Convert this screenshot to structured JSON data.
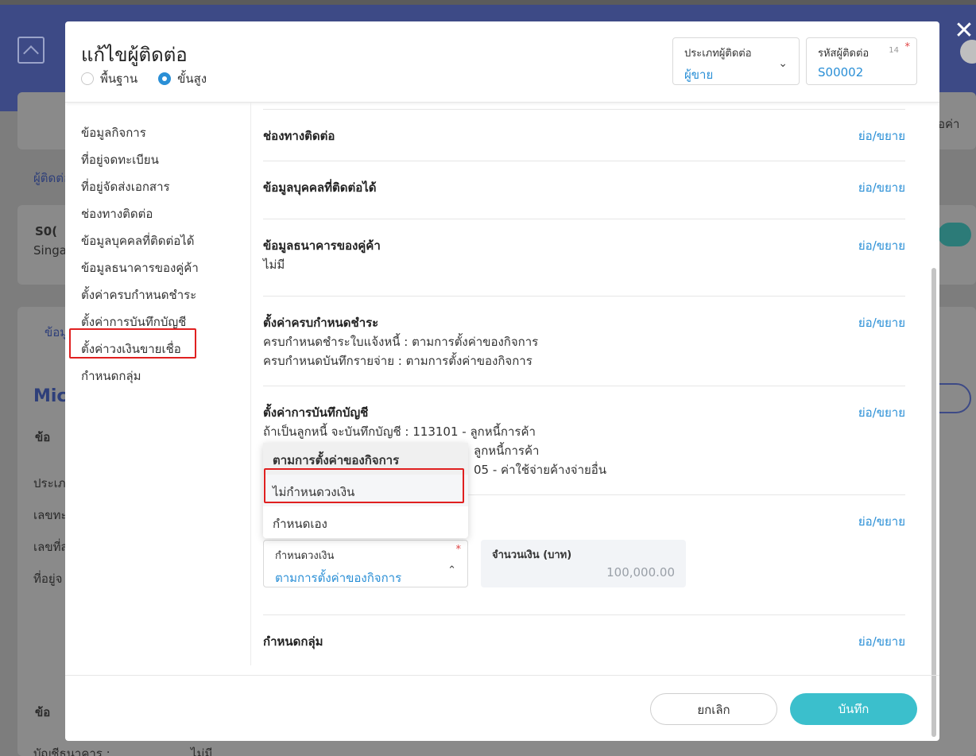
{
  "background": {
    "breadcrumb": "ผู้ติดต่อ",
    "contact_code": "S0(",
    "country": "Singap",
    "tab_label": "ข้อมู",
    "heading": "Mic",
    "section_a": "ข้อ",
    "rows": [
      "ประเภ",
      "เลขทะ",
      "เลขที่ส",
      "ที่อยู่จ"
    ],
    "section_b": "ข้อ",
    "bank_label": "บัญชีธนาคาร :",
    "bank_value": "ไม่มี",
    "right_text": "อค่า"
  },
  "modal": {
    "title": "แก้ไขผู้ติดต่อ",
    "mode_basic": "พื้นฐาน",
    "mode_advanced": "ขั้นสูง",
    "contact_type": {
      "label": "ประเภทผู้ติดต่อ",
      "value": "ผู้ขาย"
    },
    "contact_code": {
      "label": "รหัสผู้ติดต่อ",
      "value": "S00002",
      "count": "14"
    }
  },
  "nav": [
    "ข้อมูลกิจการ",
    "ที่อยู่จดทะเบียน",
    "ที่อยู่จัดส่งเอกสาร",
    "ช่องทางติดต่อ",
    "ข้อมูลบุคคลที่ติดต่อได้",
    "ข้อมูลธนาคารของคู่ค้า",
    "ตั้งค่าครบกำหนดชำระ",
    "ตั้งค่าการบันทึกบัญชี",
    "ตั้งค่าวงเงินขายเชื่อ",
    "กำหนดกลุ่ม"
  ],
  "toggle_label": "ย่อ/ขยาย",
  "sections": {
    "channel": {
      "title": "ช่องทางติดต่อ"
    },
    "person": {
      "title": "ข้อมูลบุคคลที่ติดต่อได้"
    },
    "bank": {
      "title": "ข้อมูลธนาคารของคู่ค้า",
      "text": "ไม่มี"
    },
    "due": {
      "title": "ตั้งค่าครบกำหนดชำระ",
      "line1": "ครบกำหนดชำระใบแจ้งหนี้ : ตามการตั้งค่าของกิจการ",
      "line2": "ครบกำหนดบันทึกรายจ่าย : ตามการตั้งค่าของกิจการ"
    },
    "accounting": {
      "title": "ตั้งค่าการบันทึกบัญชี",
      "line1": "ถ้าเป็นลูกหนี้ จะบันทึกบัญชี : 113101 - ลูกหนี้การค้า",
      "line2_visible": "ลูกหนี้การค้า",
      "line3_visible": "05 - ค่าใช้จ่ายค้างจ่ายอื่น"
    },
    "group": {
      "title": "กำหนดกลุ่ม"
    }
  },
  "dropdown": {
    "options": [
      "ตามการตั้งค่าของกิจการ",
      "ไม่กำหนดวงเงิน",
      "กำหนดเอง"
    ]
  },
  "credit_limit": {
    "label": "กำหนดวงเงิน",
    "value": "ตามการตั้งค่าของกิจการ",
    "amount_label": "จำนวนเงิน (บาท)",
    "amount_value": "100,000.00"
  },
  "footer": {
    "cancel": "ยกเลิก",
    "save": "บันทึก"
  }
}
